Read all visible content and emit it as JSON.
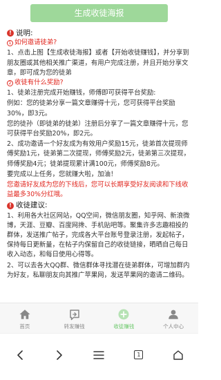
{
  "header": {
    "generate_button": "生成收徒海报"
  },
  "content": {
    "section1_title": "说明:",
    "q1": {
      "num": "1",
      "text": "如何邀请徒弟?"
    },
    "q1_p1": "1、点击上图【生成收徒海报】或者【开始收徒赚钱】，并分享到朋友圈或其他相关推广渠道，有用户完成注册，并且开始分享文章，即可成为您的徒弟",
    "q2": {
      "num": "2",
      "text": "收徒有什么奖励?"
    },
    "q2_p1": "1、徒弟注册完成开始赚钱，师傅即可获得平台奖励:",
    "q2_p2": "例如：您的徒弟分享一篇文章赚得十元，您可获得平台奖励30%，即3元。",
    "q2_p3": "您的徒孙（即徒弟的徒弟）注册后分享了一篇文章赚得十元，您可获得平台奖励20%，即2元。",
    "q2_p4": "2、成功邀请一个好友成为有效用户奖励15元，徒弟首次提现师傅奖励1元，徒弟第二次提现，师傅奖励2元，徒弟第三次提现，师傅奖励4元；徒弟提现累计满100元，师傅奖励8元。",
    "q2_p5": "要完成以上任务，您就赚大啦，加油！",
    "q2_red": "您邀请好友成为您的下线后，您可以长期享受好友阅读和下线收益最多30%分红哦。",
    "section2_title": "收徒建议:",
    "s2_p1": "1、利用各大社区网站，QQ空间，微信朋友圈，知乎网、新浪微博，天涯、豆瓣、百度网搀、手机贴吧等。聚集许多志趣相投的群体，发送推广帖子，完成各大平台账号登录注册，发起帖子，保持每日更新量，在帖子内保留自己的收徒链接，晒晒自己每日收入动态，和每日使用心得等。",
    "s2_p2": "2、可以去各大QQ群、微信群体寻找潜在徒弟群体，可增加群内为好友，私聊朋友向其推广苹果网，发送苹果网的邀请二维码。"
  },
  "tabbar": {
    "items": [
      {
        "label": "首页",
        "icon": "home-icon"
      },
      {
        "label": "转发赚钱",
        "icon": "forward-icon"
      },
      {
        "label": "收徒赚钱",
        "icon": "add-circle-icon",
        "active": true
      },
      {
        "label": "个人中心",
        "icon": "person-icon"
      }
    ]
  },
  "navbar": {
    "tab_count": "1"
  },
  "colors": {
    "accent": "#6cc86b",
    "button_bg": "#9ed89a",
    "red": "#e0261e"
  }
}
